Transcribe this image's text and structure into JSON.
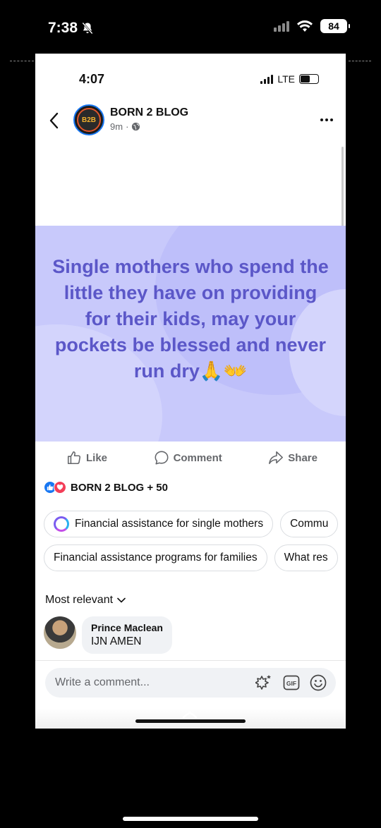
{
  "outer_status": {
    "time": "7:38",
    "battery": "84"
  },
  "inner_status": {
    "time": "4:07",
    "network": "LTE"
  },
  "post": {
    "page_name": "BORN 2 BLOG",
    "time_ago": "9m",
    "separator": "·",
    "logo_text": "B2B",
    "text": "Single mothers who spend the little they have on providing for their kids, may your pockets be blessed and never run dry🙏👐",
    "card_color": "#c8c9fb",
    "text_color": "#5b57c8"
  },
  "actions": {
    "like": "Like",
    "comment": "Comment",
    "share": "Share"
  },
  "reactions": {
    "summary": "BORN 2 BLOG + 50"
  },
  "suggestions": {
    "row1": [
      "Financial assistance for single mothers",
      "Commu"
    ],
    "row2": [
      "Financial assistance programs for families",
      "What res"
    ]
  },
  "sort": {
    "label": "Most relevant"
  },
  "comments": [
    {
      "name": "Prince Maclean",
      "text": "IJN AMEN"
    }
  ],
  "composer": {
    "placeholder": "Write a comment..."
  },
  "colors": {
    "accent": "#1877f2",
    "love": "#f33e58"
  }
}
